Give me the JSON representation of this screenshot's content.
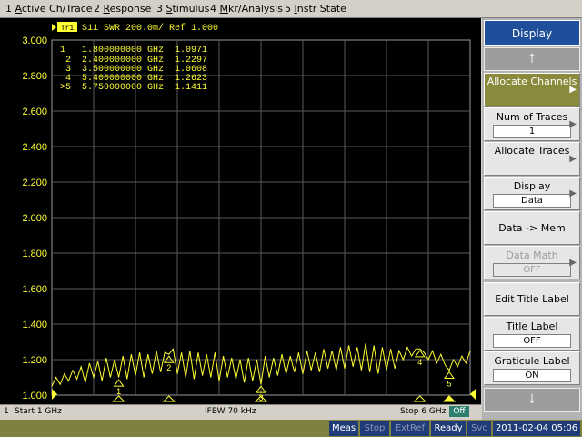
{
  "menubar": {
    "items": [
      {
        "num": "1 ",
        "key": "A",
        "rest": "ctive Ch/Trace"
      },
      {
        "num": "2 ",
        "key": "R",
        "rest": "esponse"
      },
      {
        "num": "3 ",
        "key": "S",
        "rest": "timulus"
      },
      {
        "num": "4 ",
        "key": "M",
        "rest": "kr/Analysis"
      },
      {
        "num": "5 ",
        "key": "I",
        "rest": "nstr State"
      }
    ]
  },
  "trace": {
    "badge": "Tr1",
    "header": "S11  SWR 200.0m/ Ref 1.000",
    "color": "#ffff33"
  },
  "markers": [
    {
      "label": "1",
      "freq": "1.800000000 GHz",
      "value": "1.0971"
    },
    {
      "label": "2",
      "freq": "2.400000000 GHz",
      "value": "1.2297"
    },
    {
      "label": "3",
      "freq": "3.500000000 GHz",
      "value": "1.0608"
    },
    {
      "label": "4",
      "freq": "5.400000000 GHz",
      "value": "1.2623"
    },
    {
      "label": ">5",
      "freq": "5.750000000 GHz",
      "value": "1.1411"
    }
  ],
  "status": {
    "channel": "1",
    "start": "Start 1 GHz",
    "ifbw": "IFBW 70 kHz",
    "stop": "Stop 6 GHz",
    "off": "Off"
  },
  "taskbar": {
    "meas": "Meas",
    "stop": "Stop",
    "extref": "ExtRef",
    "ready": "Ready",
    "svc": "Svc",
    "datetime": "2011-02-04 05:06"
  },
  "softkeys": {
    "title": "Display",
    "up_arrow": "↑",
    "down_arrow": "↓",
    "allocate_channels": "Allocate Channels",
    "num_traces_label": "Num of Traces",
    "num_traces_value": "1",
    "allocate_traces": "Allocate Traces",
    "display_label": "Display",
    "display_value": "Data",
    "data_to_mem": "Data -> Mem",
    "data_math_label": "Data Math",
    "data_math_value": "OFF",
    "edit_title_label": "Edit Title Label",
    "title_label": "Title Label",
    "title_label_value": "OFF",
    "graticule_label": "Graticule Label",
    "graticule_label_value": "ON"
  },
  "chart_data": {
    "type": "line",
    "title": "S11  SWR 200.0m/ Ref 1.000",
    "xlabel": "",
    "ylabel": "",
    "xlim": [
      1.0,
      6.0
    ],
    "ylim": [
      1.0,
      3.0
    ],
    "y_ticks": [
      "3.000",
      "2.800",
      "2.600",
      "2.400",
      "2.200",
      "2.000",
      "1.800",
      "1.600",
      "1.400",
      "1.200",
      "1.000"
    ],
    "grid": true,
    "series": [
      {
        "x": [
          1.0,
          1.05,
          1.1,
          1.15,
          1.2,
          1.25,
          1.3,
          1.35,
          1.4,
          1.45,
          1.5,
          1.55,
          1.6,
          1.65,
          1.7,
          1.75,
          1.8,
          1.85,
          1.9,
          1.95,
          2.0,
          2.05,
          2.1,
          2.15,
          2.2,
          2.25,
          2.3,
          2.35,
          2.4,
          2.45,
          2.5,
          2.55,
          2.6,
          2.65,
          2.7,
          2.75,
          2.8,
          2.85,
          2.9,
          2.95,
          3.0,
          3.05,
          3.1,
          3.15,
          3.2,
          3.25,
          3.3,
          3.35,
          3.4,
          3.45,
          3.5,
          3.55,
          3.6,
          3.65,
          3.7,
          3.75,
          3.8,
          3.85,
          3.9,
          3.95,
          4.0,
          4.05,
          4.1,
          4.15,
          4.2,
          4.25,
          4.3,
          4.35,
          4.4,
          4.45,
          4.5,
          4.55,
          4.6,
          4.65,
          4.7,
          4.75,
          4.8,
          4.85,
          4.9,
          4.95,
          5.0,
          5.05,
          5.1,
          5.15,
          5.2,
          5.25,
          5.3,
          5.35,
          5.4,
          5.45,
          5.5,
          5.55,
          5.6,
          5.65,
          5.7,
          5.75,
          5.8,
          5.85,
          5.9,
          5.95,
          6.0
        ],
        "values": [
          1.05,
          1.1,
          1.06,
          1.12,
          1.08,
          1.14,
          1.09,
          1.16,
          1.07,
          1.18,
          1.1,
          1.19,
          1.08,
          1.21,
          1.1,
          1.2,
          1.1,
          1.22,
          1.09,
          1.23,
          1.11,
          1.24,
          1.1,
          1.23,
          1.12,
          1.25,
          1.13,
          1.24,
          1.23,
          1.26,
          1.12,
          1.24,
          1.1,
          1.25,
          1.09,
          1.24,
          1.11,
          1.23,
          1.1,
          1.24,
          1.08,
          1.22,
          1.1,
          1.21,
          1.09,
          1.2,
          1.07,
          1.21,
          1.08,
          1.2,
          1.06,
          1.22,
          1.1,
          1.21,
          1.11,
          1.23,
          1.12,
          1.22,
          1.13,
          1.24,
          1.12,
          1.25,
          1.14,
          1.24,
          1.13,
          1.26,
          1.15,
          1.25,
          1.14,
          1.27,
          1.15,
          1.28,
          1.16,
          1.27,
          1.14,
          1.29,
          1.13,
          1.28,
          1.12,
          1.27,
          1.14,
          1.26,
          1.15,
          1.25,
          1.2,
          1.27,
          1.22,
          1.26,
          1.26,
          1.24,
          1.2,
          1.25,
          1.18,
          1.23,
          1.17,
          1.14,
          1.2,
          1.16,
          1.22,
          1.18,
          1.25
        ]
      }
    ]
  }
}
